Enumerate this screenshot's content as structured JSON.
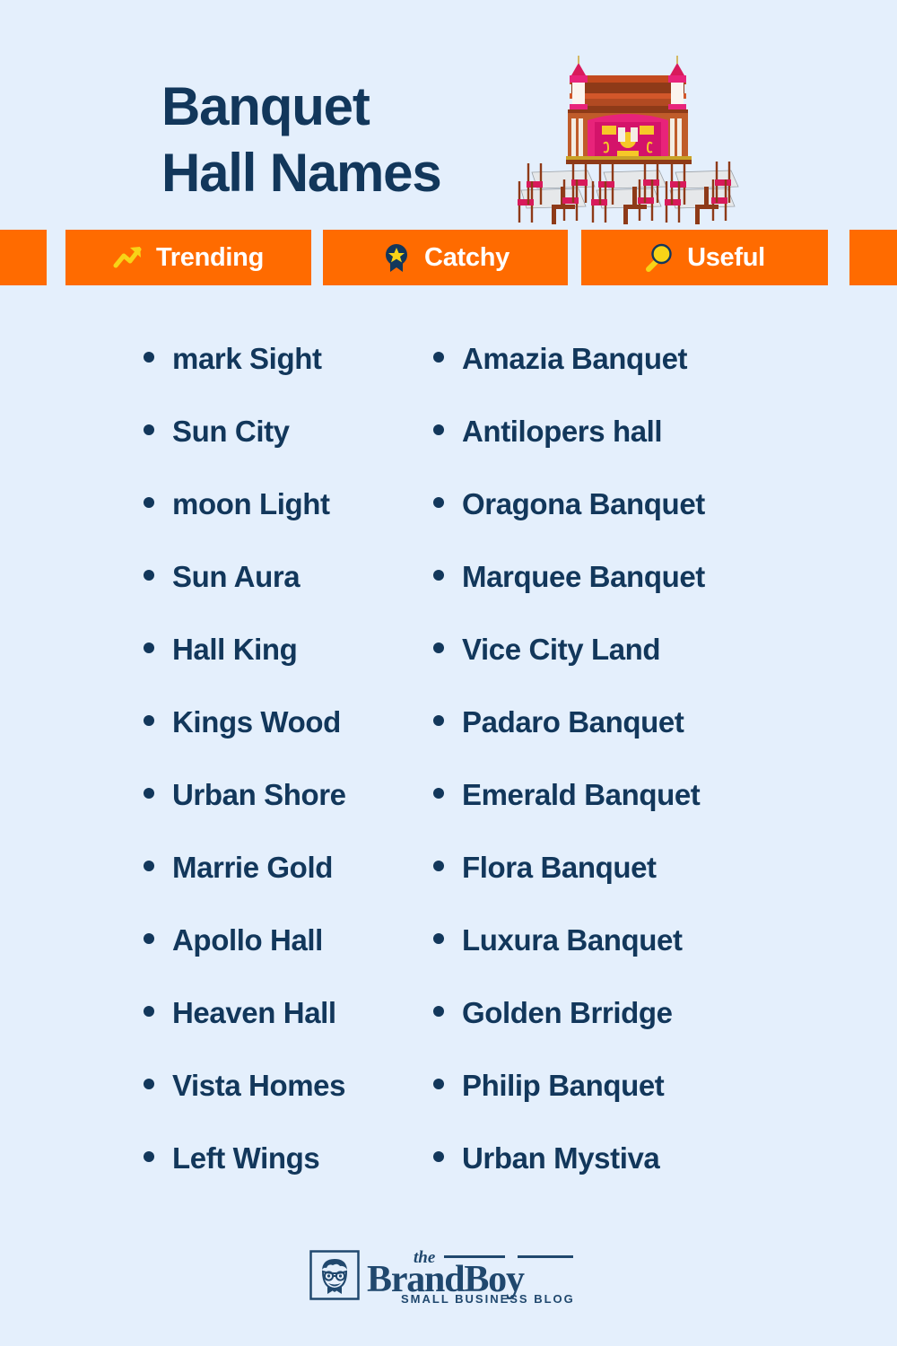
{
  "theme": {
    "background": "#E4EFFC",
    "navy": "#12375B",
    "orange": "#FF6B00",
    "yellow": "#F7D417",
    "white": "#FFFFFF",
    "logo_blue": "#20486E"
  },
  "header": {
    "title_line1": "Banquet",
    "title_line2": "Hall Names",
    "illustration_name": "banquet-hall-illustration"
  },
  "badges": [
    {
      "label": "Trending",
      "icon": "trending-arrow-icon"
    },
    {
      "label": "Catchy",
      "icon": "ribbon-star-icon"
    },
    {
      "label": "Useful",
      "icon": "magnifying-glass-icon"
    }
  ],
  "lists": {
    "left_column": [
      "mark Sight",
      "Sun City",
      "moon Light",
      "Sun Aura",
      "Hall King",
      "Kings Wood",
      "Urban Shore",
      "Marrie Gold",
      "Apollo Hall",
      "Heaven Hall",
      "Vista Homes",
      "Left Wings"
    ],
    "right_column": [
      "Amazia Banquet",
      "Antilopers hall",
      "Oragona Banquet",
      "Marquee Banquet",
      "Vice City Land",
      "Padaro Banquet",
      "Emerald Banquet",
      "Flora Banquet",
      "Luxura Banquet",
      "Golden Brridge",
      "Philip Banquet",
      "Urban Mystiva"
    ]
  },
  "footer": {
    "logo_the": "the",
    "logo_main": "BrandBoy",
    "logo_sub": "SMALL BUSINESS BLOG",
    "logo_mark_name": "brandboy-boy-face-icon"
  }
}
